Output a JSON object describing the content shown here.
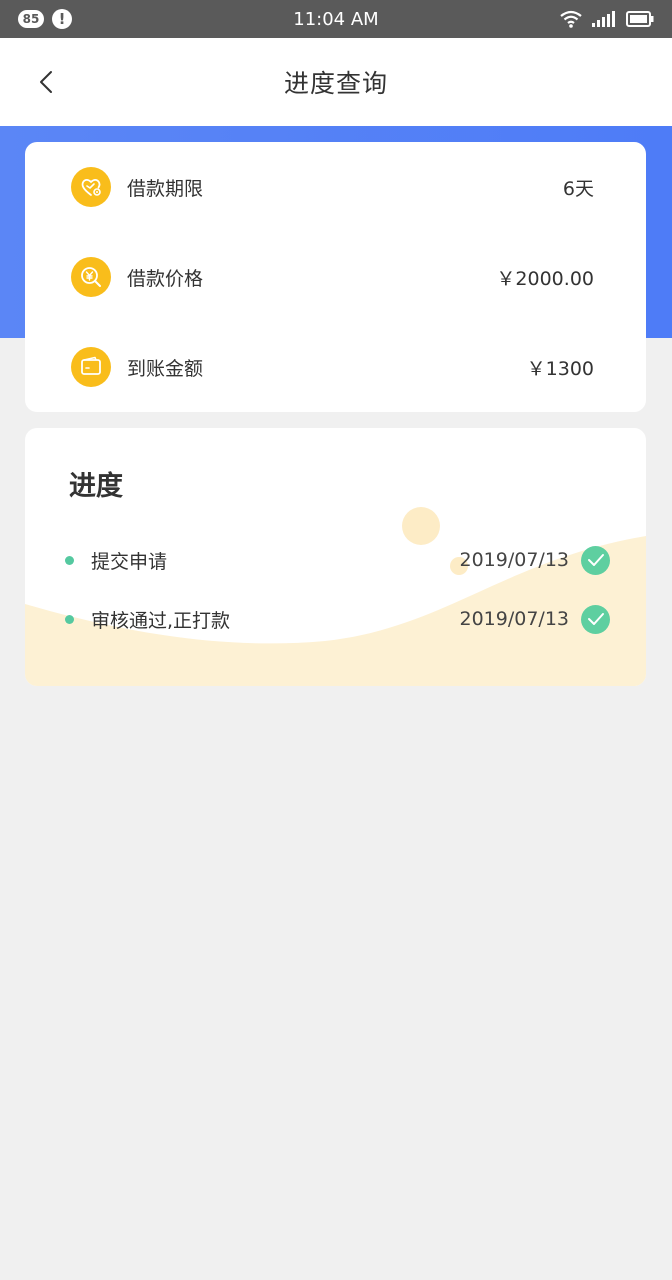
{
  "status_bar": {
    "badge_count": "85",
    "alert_glyph": "!",
    "time": "11:04 AM",
    "icons": [
      "wifi-icon",
      "signal-icon",
      "battery-icon"
    ]
  },
  "nav": {
    "title": "进度查询",
    "back_icon": "chevron-left-icon"
  },
  "loan_info": [
    {
      "icon": "heart-gear-icon",
      "label": "借款期限",
      "value": "6天"
    },
    {
      "icon": "yen-search-icon",
      "label": "借款价格",
      "value": "￥2000.00"
    },
    {
      "icon": "wallet-icon",
      "label": "到账金额",
      "value": "￥1300"
    }
  ],
  "progress": {
    "title": "进度",
    "steps": [
      {
        "label": "提交申请",
        "date": "2019/07/13",
        "done": true
      },
      {
        "label": "审核通过,正打款",
        "date": "2019/07/13",
        "done": true
      }
    ]
  },
  "colors": {
    "status_bar": "#5a5a5a",
    "header_blue": "#5b86f6",
    "icon_yellow": "#f9bd1b",
    "accent_green": "#5ecfa0",
    "wave_cream": "#fdf1d4",
    "page_bg": "#f0f0f0"
  }
}
